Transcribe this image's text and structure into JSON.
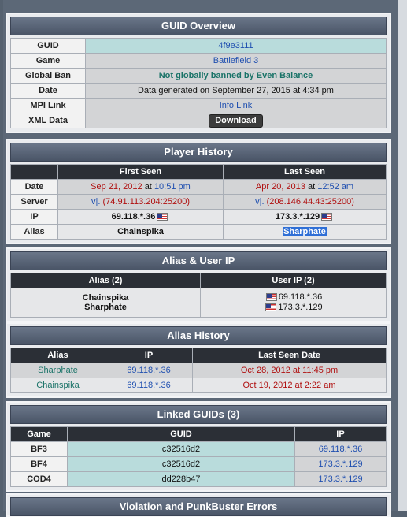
{
  "guid_overview": {
    "title": "GUID Overview",
    "rows": [
      {
        "label": "GUID",
        "value": "4f9e3111"
      },
      {
        "label": "Game",
        "value": "Battlefield 3"
      },
      {
        "label": "Global Ban",
        "value": "Not globally banned by Even Balance"
      },
      {
        "label": "Date",
        "value": "Data generated on September 27, 2015 at 4:34 pm"
      },
      {
        "label": "MPI Link",
        "value": "Info Link"
      },
      {
        "label": "XML Data",
        "value": "Download"
      }
    ]
  },
  "player_history": {
    "title": "Player History",
    "headers": [
      "First Seen",
      "Last Seen"
    ],
    "date_label": "Date",
    "first_date": "Sep 21, 2012",
    "first_time": "10:51 pm",
    "last_date": "Apr 20, 2013",
    "last_time": "12:52 am",
    "at_word": "at",
    "server_label": "Server",
    "first_server_prefix": "v|.",
    "first_server": "(74.91.113.204:25200)",
    "last_server_prefix": "v|.",
    "last_server": "(208.146.44.43:25200)",
    "ip_label": "IP",
    "first_ip": "69.118.*.36",
    "last_ip": "173.3.*.129",
    "alias_label": "Alias",
    "first_alias": "Chainspika",
    "last_alias": "Sharphate"
  },
  "alias_user_ip": {
    "title": "Alias & User IP",
    "headers": [
      "Alias (2)",
      "User IP (2)"
    ],
    "aliases": [
      "Chainspika",
      "Sharphate"
    ],
    "ips": [
      "69.118.*.36",
      "173.3.*.129"
    ]
  },
  "alias_history": {
    "title": "Alias History",
    "headers": [
      "Alias",
      "IP",
      "Last Seen Date"
    ],
    "rows": [
      {
        "alias": "Sharphate",
        "ip": "69.118.*.36",
        "date": "Oct 28, 2012 at 11:45 pm"
      },
      {
        "alias": "Chainspika",
        "ip": "69.118.*.36",
        "date": "Oct 19, 2012 at 2:22 am"
      }
    ]
  },
  "linked_guids": {
    "title": "Linked GUIDs (3)",
    "headers": [
      "Game",
      "GUID",
      "IP"
    ],
    "rows": [
      {
        "game": "BF3",
        "guid": "c32516d2",
        "ip": "69.118.*.36"
      },
      {
        "game": "BF4",
        "guid": "c32516d2",
        "ip": "173.3.*.129"
      },
      {
        "game": "COD4",
        "guid": "dd228b47",
        "ip": "173.3.*.129"
      }
    ]
  },
  "violations": {
    "title": "Violation and PunkBuster Errors"
  }
}
